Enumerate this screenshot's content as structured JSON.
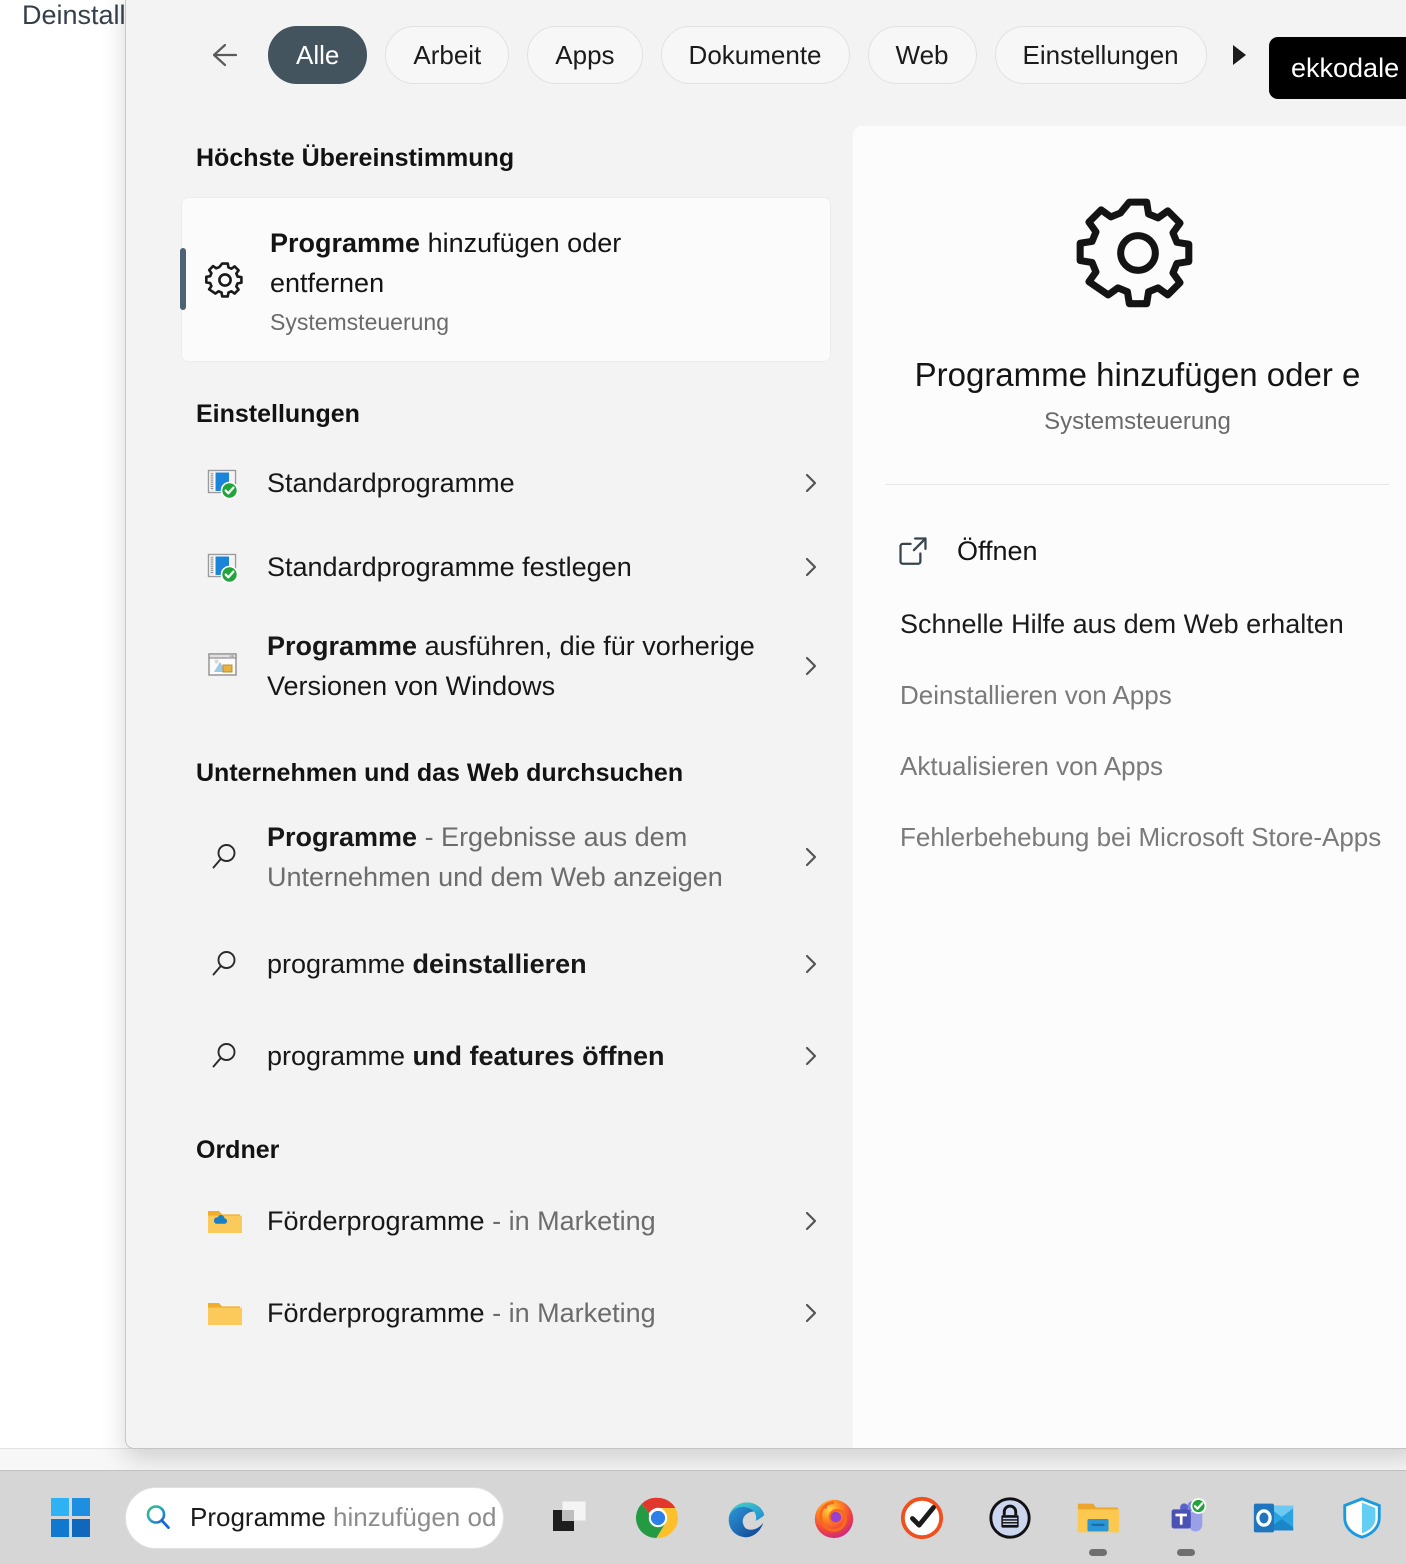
{
  "background": {
    "window_text": "Deinstall"
  },
  "header": {
    "back_icon": "back-arrow-icon",
    "more_icon": "more-tabs-arrow-icon",
    "tabs": [
      {
        "label": "Alle",
        "active": true
      },
      {
        "label": "Arbeit",
        "active": false
      },
      {
        "label": "Apps",
        "active": false
      },
      {
        "label": "Dokumente",
        "active": false
      },
      {
        "label": "Web",
        "active": false
      },
      {
        "label": "Einstellungen",
        "active": false
      }
    ],
    "org_badge": "ekkodale Gm"
  },
  "results": {
    "best_match": {
      "section_title": "Höchste Übereinstimmung",
      "icon": "gear-icon",
      "title_bold": "Programme",
      "title_rest": " hinzufügen oder entfernen",
      "subtitle": "Systemsteuerung"
    },
    "settings": {
      "section_title": "Einstellungen",
      "items": [
        {
          "icon": "default-programs-icon",
          "bold": "",
          "text": "Standardprogramme",
          "chevron": "chevron-right-icon"
        },
        {
          "icon": "default-programs-icon",
          "bold": "",
          "text": "Standardprogramme festlegen",
          "chevron": "chevron-right-icon"
        },
        {
          "icon": "compatibility-icon",
          "bold": "Programme",
          "text": " ausführen, die für vorherige Versionen von Windows",
          "chevron": "chevron-right-icon"
        }
      ]
    },
    "web": {
      "section_title": "Unternehmen und das Web durchsuchen",
      "items": [
        {
          "icon": "search-icon",
          "bold": "Programme",
          "muted": " - Ergebnisse aus dem Unternehmen und dem Web anzeigen",
          "chevron": "chevron-right-icon"
        },
        {
          "icon": "search-icon",
          "plain": "programme ",
          "bold": "deinstallieren",
          "chevron": "chevron-right-icon"
        },
        {
          "icon": "search-icon",
          "plain": "programme ",
          "bold": "und features öffnen",
          "chevron": "chevron-right-icon"
        }
      ]
    },
    "folders": {
      "section_title": "Ordner",
      "items": [
        {
          "icon": "folder-onedrive-icon",
          "name": "Förderprogramme",
          "location": " - in Marketing",
          "chevron": "chevron-right-icon"
        },
        {
          "icon": "folder-icon",
          "name": "Förderprogramme",
          "location": " - in Marketing",
          "chevron": "chevron-right-icon"
        }
      ]
    }
  },
  "preview": {
    "icon": "gear-icon",
    "title": "Programme hinzufügen oder e",
    "subtitle": "Systemsteuerung",
    "open_icon": "external-link-icon",
    "open_label": "Öffnen",
    "help_heading": "Schnelle Hilfe aus dem Web erhalten",
    "links": [
      "Deinstallieren von Apps",
      "Aktualisieren von Apps",
      "Fehlerbehebung bei Microsoft Store-Apps"
    ]
  },
  "taskbar": {
    "start_icon": "windows-start-icon",
    "search_icon": "search-icon",
    "search_typed": "Programme",
    "search_ghost": " hinzufügen od",
    "apps": [
      {
        "icon": "task-view-icon",
        "running": false
      },
      {
        "icon": "google-chrome-icon",
        "running": false
      },
      {
        "icon": "microsoft-edge-icon",
        "running": false
      },
      {
        "icon": "mozilla-firefox-icon",
        "running": true
      },
      {
        "icon": "todo-check-icon",
        "running": false
      },
      {
        "icon": "keepass-icon",
        "running": false
      },
      {
        "icon": "file-explorer-icon",
        "running": true
      },
      {
        "icon": "microsoft-teams-icon",
        "running": true
      },
      {
        "icon": "microsoft-outlook-icon",
        "running": false
      },
      {
        "icon": "security-shield-icon",
        "running": false
      }
    ]
  },
  "colors": {
    "accent_tab": "#44545f",
    "selection_bar": "#4d6375",
    "panel_bg": "#f3f3f3",
    "preview_bg": "#fcfcfc",
    "taskbar_bg": "#d6d6d6",
    "badge_bg": "#000000"
  }
}
